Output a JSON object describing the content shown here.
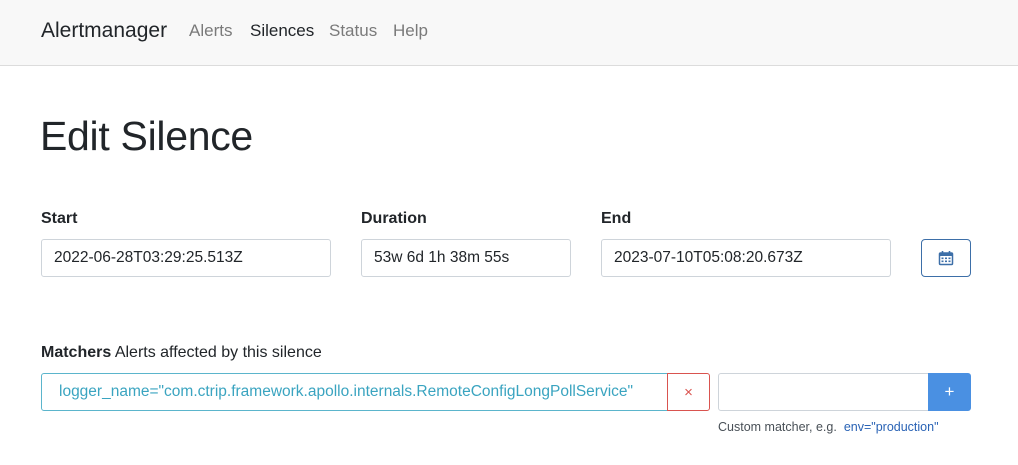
{
  "app": {
    "brand": "Alertmanager"
  },
  "nav": {
    "alerts": "Alerts",
    "silences": "Silences",
    "status": "Status",
    "help": "Help",
    "active": "Silences"
  },
  "page": {
    "title": "Edit Silence"
  },
  "form": {
    "start": {
      "label": "Start",
      "value": "2022-06-28T03:29:25.513Z"
    },
    "duration": {
      "label": "Duration",
      "value": "53w 6d 1h 38m 55s"
    },
    "end": {
      "label": "End",
      "value": "2023-07-10T05:08:20.673Z"
    },
    "calendar_icon": "calendar-icon"
  },
  "matchers": {
    "label": "Matchers",
    "sublabel": "Alerts affected by this silence",
    "items": [
      {
        "text": "logger_name=\"com.ctrip.framework.apollo.internals.RemoteConfigLongPollService\""
      }
    ],
    "remove_label": "×",
    "custom_input_value": "",
    "add_label": "+",
    "hint_text": "Custom matcher, e.g.",
    "hint_example": "env=\"production\""
  },
  "colors": {
    "matcher_text": "#3aa4c0",
    "remove": "#d9534f",
    "add_button": "#4a90e2",
    "calendar_border": "#3d6fa8"
  }
}
